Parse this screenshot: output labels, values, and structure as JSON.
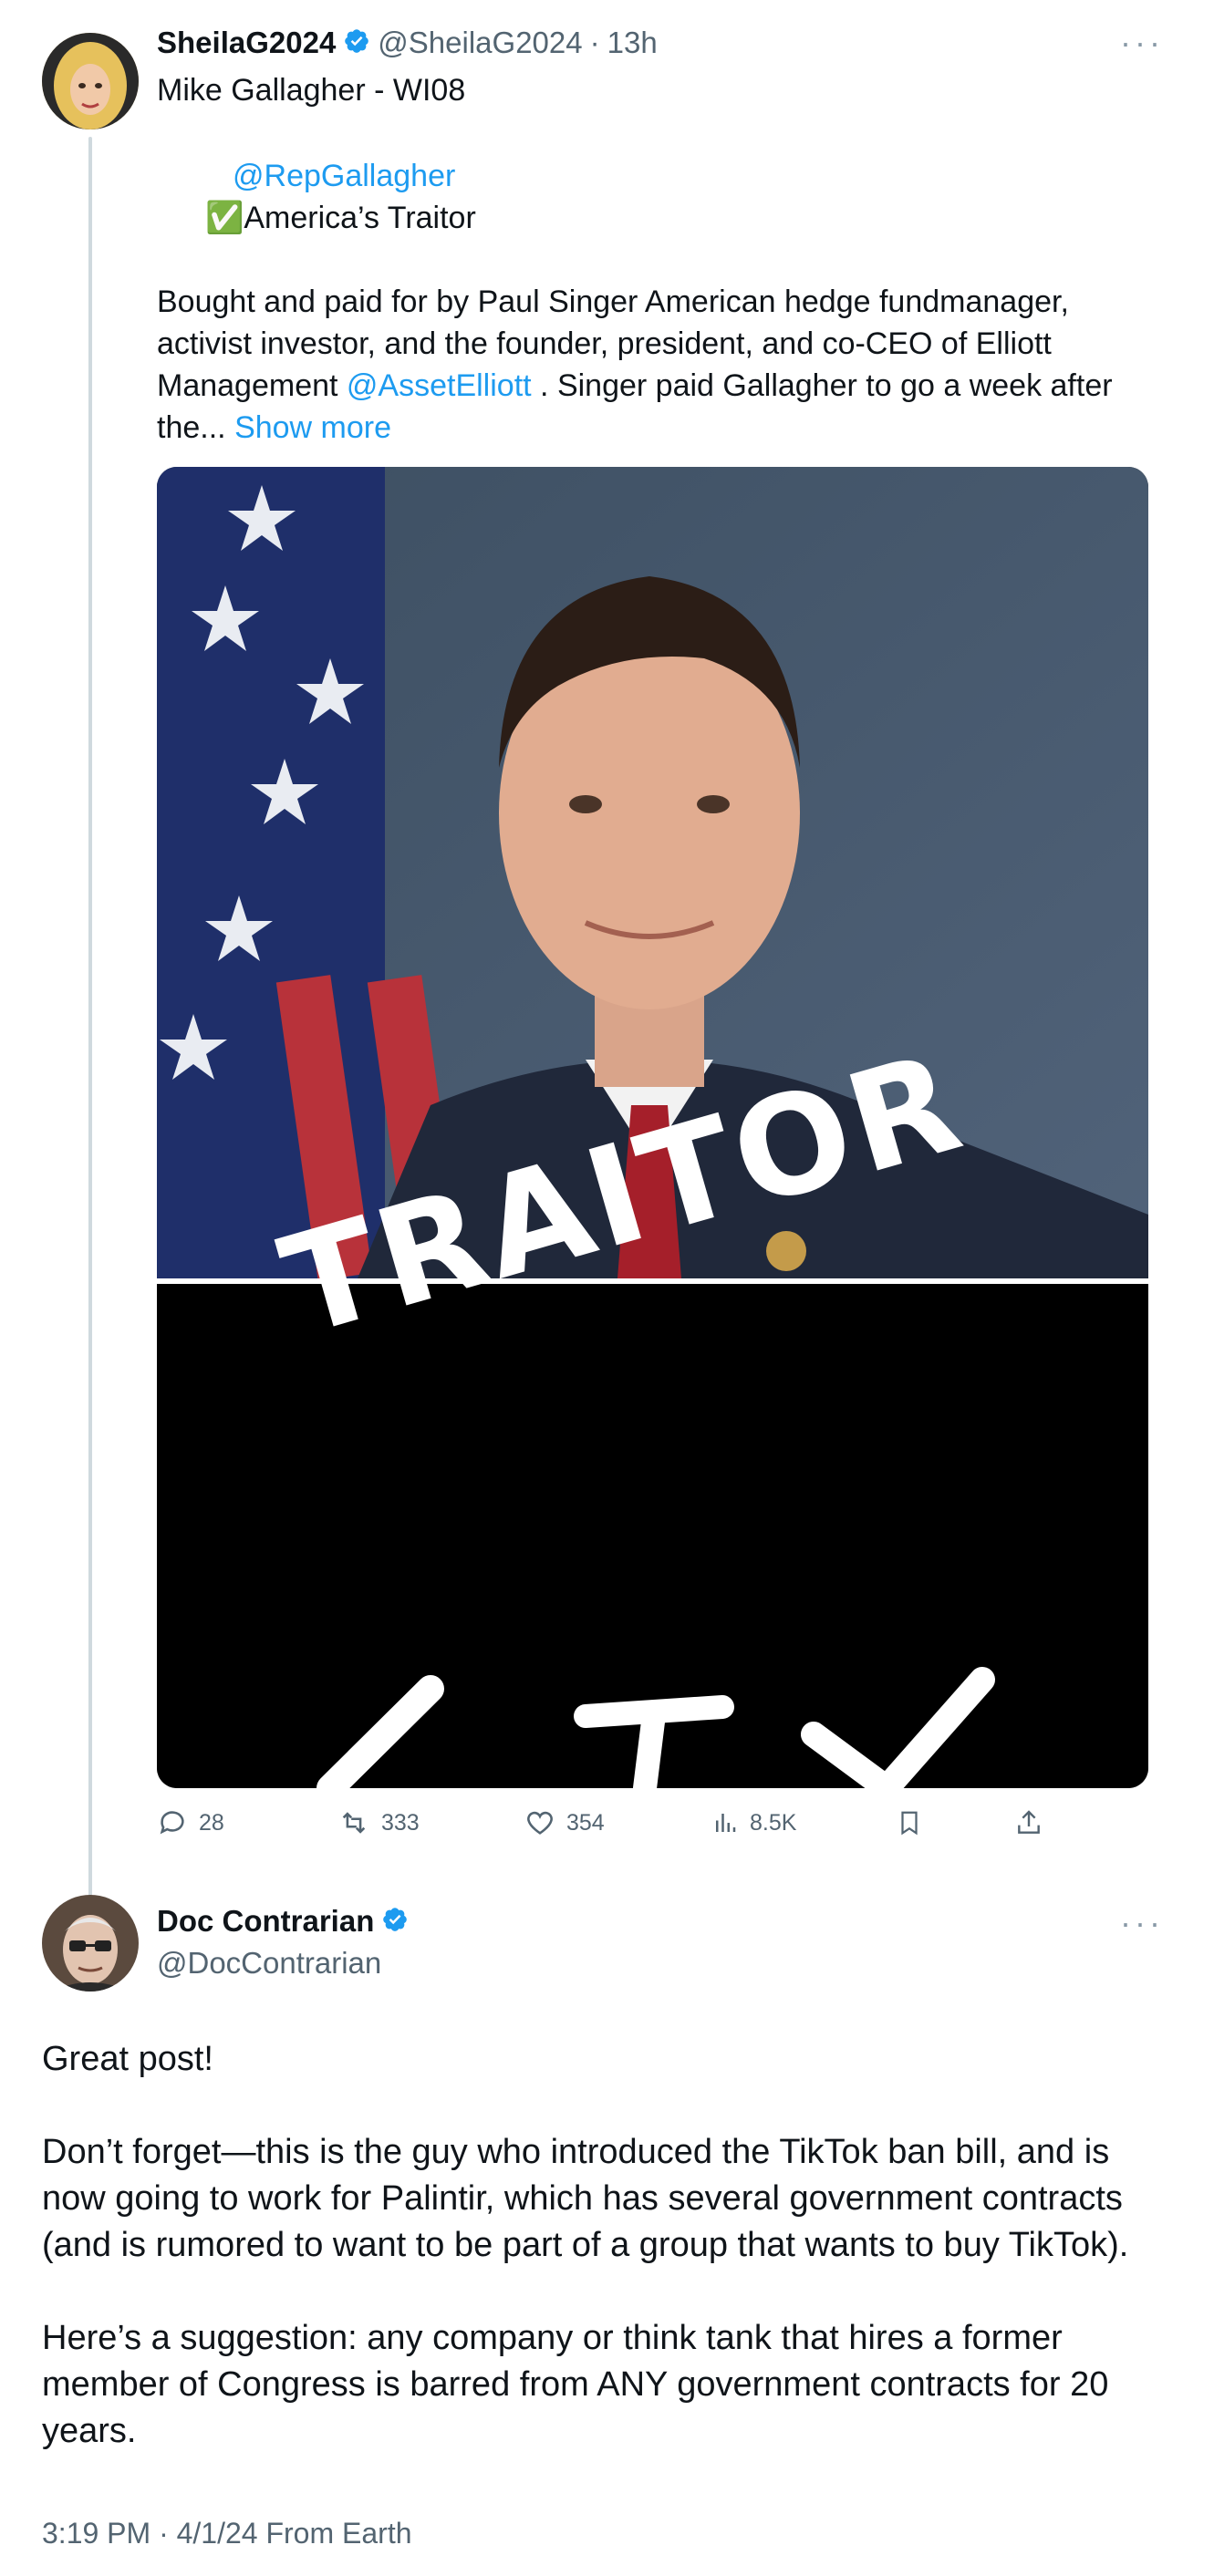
{
  "post": {
    "display_name": "SheilaG2024",
    "handle": "@SheilaG2024",
    "separator": "·",
    "time": "13h",
    "more_label": "···",
    "line1": "Mike Gallagher - WI08",
    "mention": "@RepGallagher",
    "check_emoji": "✅",
    "traitor_label": "America’s Traitor",
    "para_part1": "Bought and paid for by Paul Singer American hedge fundmanager, activist investor, and the founder, president, and co-CEO of Elliott Management ",
    "para_mention": "@AssetElliott",
    "para_part2": " . Singer paid Gallagher to go a week after the...",
    "show_more": "Show more",
    "image_text_top": "TRAITOR",
    "actions": {
      "replies": "28",
      "reposts": "333",
      "likes": "354",
      "views": "8.5K"
    }
  },
  "reply": {
    "display_name": "Doc Contrarian",
    "handle": "@DocContrarian",
    "more_label": "···",
    "paragraphs": [
      "Great post!",
      "Don’t forget—this is the guy who introduced the TikTok ban bill, and is now going to work for Palintir, which has several government contracts (and is rumored to want to be part of a group that wants to buy TikTok).",
      "Here’s a suggestion: any company or think tank that hires a former member of Congress is barred from ANY government contracts for 20 years."
    ],
    "meta": "3:19 PM · 4/1/24 From Earth"
  },
  "colors": {
    "accent": "#1d9bf0",
    "text": "#0f1419",
    "secondary": "#536471",
    "thread_line": "#cfd9de"
  }
}
